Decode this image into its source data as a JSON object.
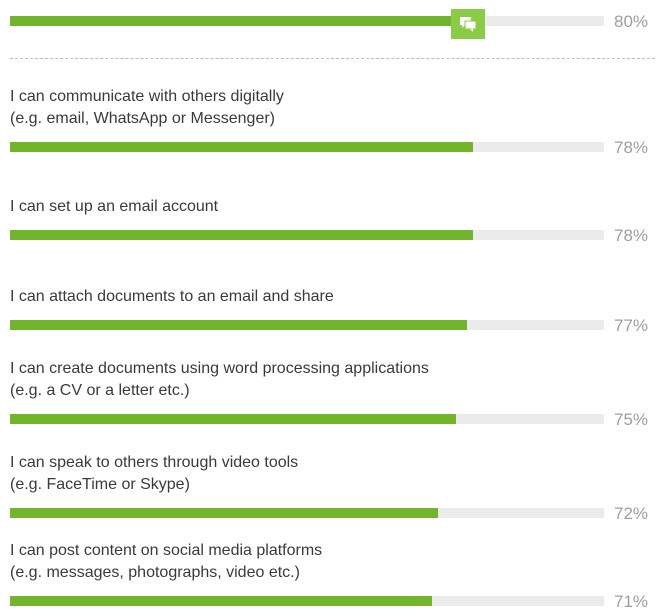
{
  "chart_data": {
    "type": "bar",
    "orientation": "horizontal",
    "xlim": [
      0,
      100
    ],
    "grid": false,
    "colors": {
      "bar": "#73b42d",
      "track": "#ebebeb",
      "highlight_icon": "#8ccb45"
    },
    "highlight": {
      "value": 80,
      "value_label": "80%",
      "icon": "chat-bubbles-icon"
    },
    "categories": [
      {
        "lines": [
          "I can communicate with others digitally",
          "(e.g. email, WhatsApp or Messenger)"
        ],
        "value": 78,
        "value_label": "78%"
      },
      {
        "lines": [
          "I can set up an email account"
        ],
        "value": 78,
        "value_label": "78%"
      },
      {
        "lines": [
          "I can attach documents to an email and share"
        ],
        "value": 77,
        "value_label": "77%"
      },
      {
        "lines": [
          "I can create documents using word processing applications",
          "(e.g. a CV or a letter etc.)"
        ],
        "value": 75,
        "value_label": "75%"
      },
      {
        "lines": [
          "I can speak to others through video tools",
          "(e.g. FaceTime or Skype)"
        ],
        "value": 72,
        "value_label": "72%"
      },
      {
        "lines": [
          "I can post content on social media platforms",
          "(e.g. messages, photographs, video etc.)"
        ],
        "value": 71,
        "value_label": "71%"
      }
    ]
  }
}
